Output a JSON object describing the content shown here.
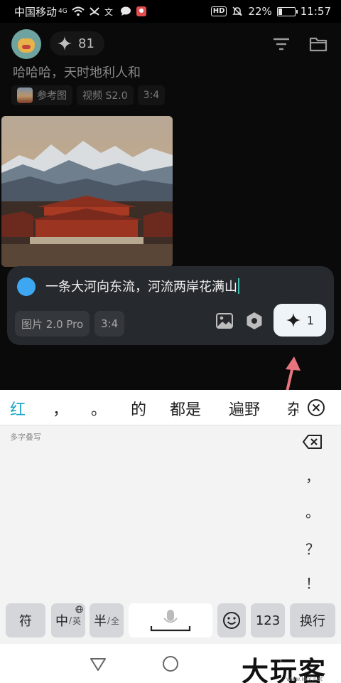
{
  "status_bar": {
    "carrier": "中国移动",
    "network": "4G",
    "battery_percent": "22%",
    "battery_level": 0.22,
    "time": "11:57"
  },
  "header": {
    "credits": "81"
  },
  "history": {
    "prompt": "哈哈哈，天时地利人和",
    "reference_label": "参考图",
    "model": "视频 S2.0",
    "ratio": "3:4"
  },
  "composer": {
    "input_value": "一条大河向东流，河流两岸花满山",
    "model_option": "图片 2.0 Pro",
    "ratio_option": "3:4",
    "generate_cost": "1",
    "accent_color": "#3ea7f2"
  },
  "keyboard": {
    "candidates": [
      "红",
      "，",
      "。",
      "的",
      "都是",
      "遍野",
      "杂"
    ],
    "hint": "多字叠写",
    "side_keys": [
      "，",
      "。",
      "？",
      "！"
    ],
    "keys": {
      "symbols": "符",
      "lang_main": "中",
      "lang_sub": "英",
      "width_main": "半",
      "width_sub": "全",
      "numbers": "123",
      "enter": "换行"
    },
    "candidate_color": "#1aa3c7"
  },
  "watermark": {
    "text": "大玩客",
    "url": "www.kkx.net"
  }
}
